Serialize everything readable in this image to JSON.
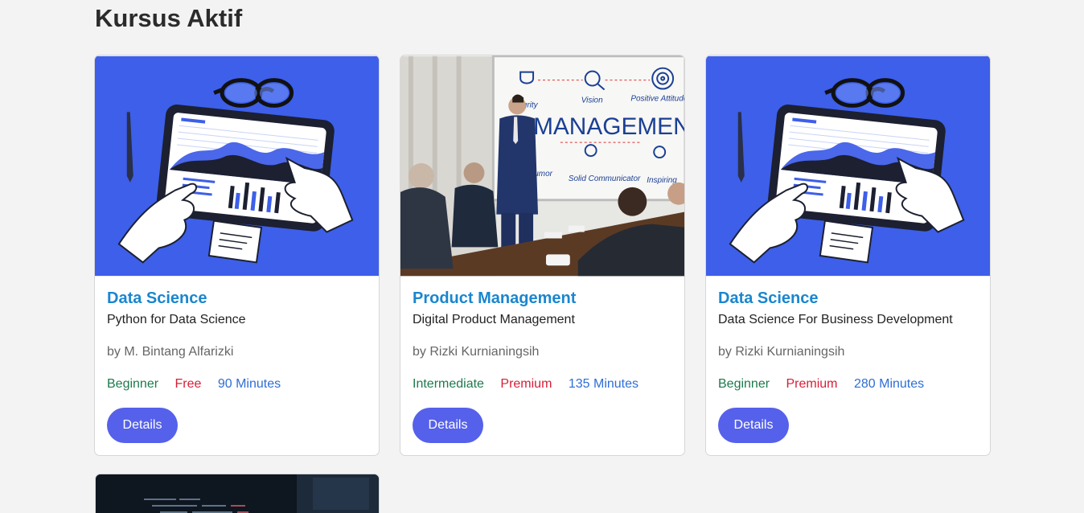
{
  "page": {
    "title": "Kursus Aktif"
  },
  "courses": [
    {
      "category": "Data Science",
      "title": "Python for Data Science",
      "author": "by M. Bintang Alfarizki",
      "level": "Beginner",
      "price": "Free",
      "duration": "90 Minutes",
      "button": "Details",
      "image": "data-dashboard-illustration"
    },
    {
      "category": "Product Management",
      "title": "Digital Product Management",
      "author": "by Rizki Kurnianingsih",
      "level": "Intermediate",
      "price": "Premium",
      "duration": "135 Minutes",
      "button": "Details",
      "image": "management-meeting-photo",
      "image_text": {
        "headline": "MANAGEMENT",
        "words": [
          "Vision",
          "Positive Attitude",
          "Integrity",
          "Humor",
          "Solid Communicator",
          "Inspiring"
        ]
      }
    },
    {
      "category": "Data Science",
      "title": "Data Science For Business Development",
      "author": "by Rizki Kurnianingsih",
      "level": "Beginner",
      "price": "Premium",
      "duration": "280 Minutes",
      "button": "Details",
      "image": "data-dashboard-illustration"
    }
  ],
  "partial_card": {
    "image": "code-screen-photo"
  },
  "colors": {
    "category": "#1a86cf",
    "level": "#1d7a4d",
    "price": "#d81e36",
    "duration": "#2f6ed6",
    "button": "#5561ea",
    "illustration_bg": "#3d5fe9"
  }
}
